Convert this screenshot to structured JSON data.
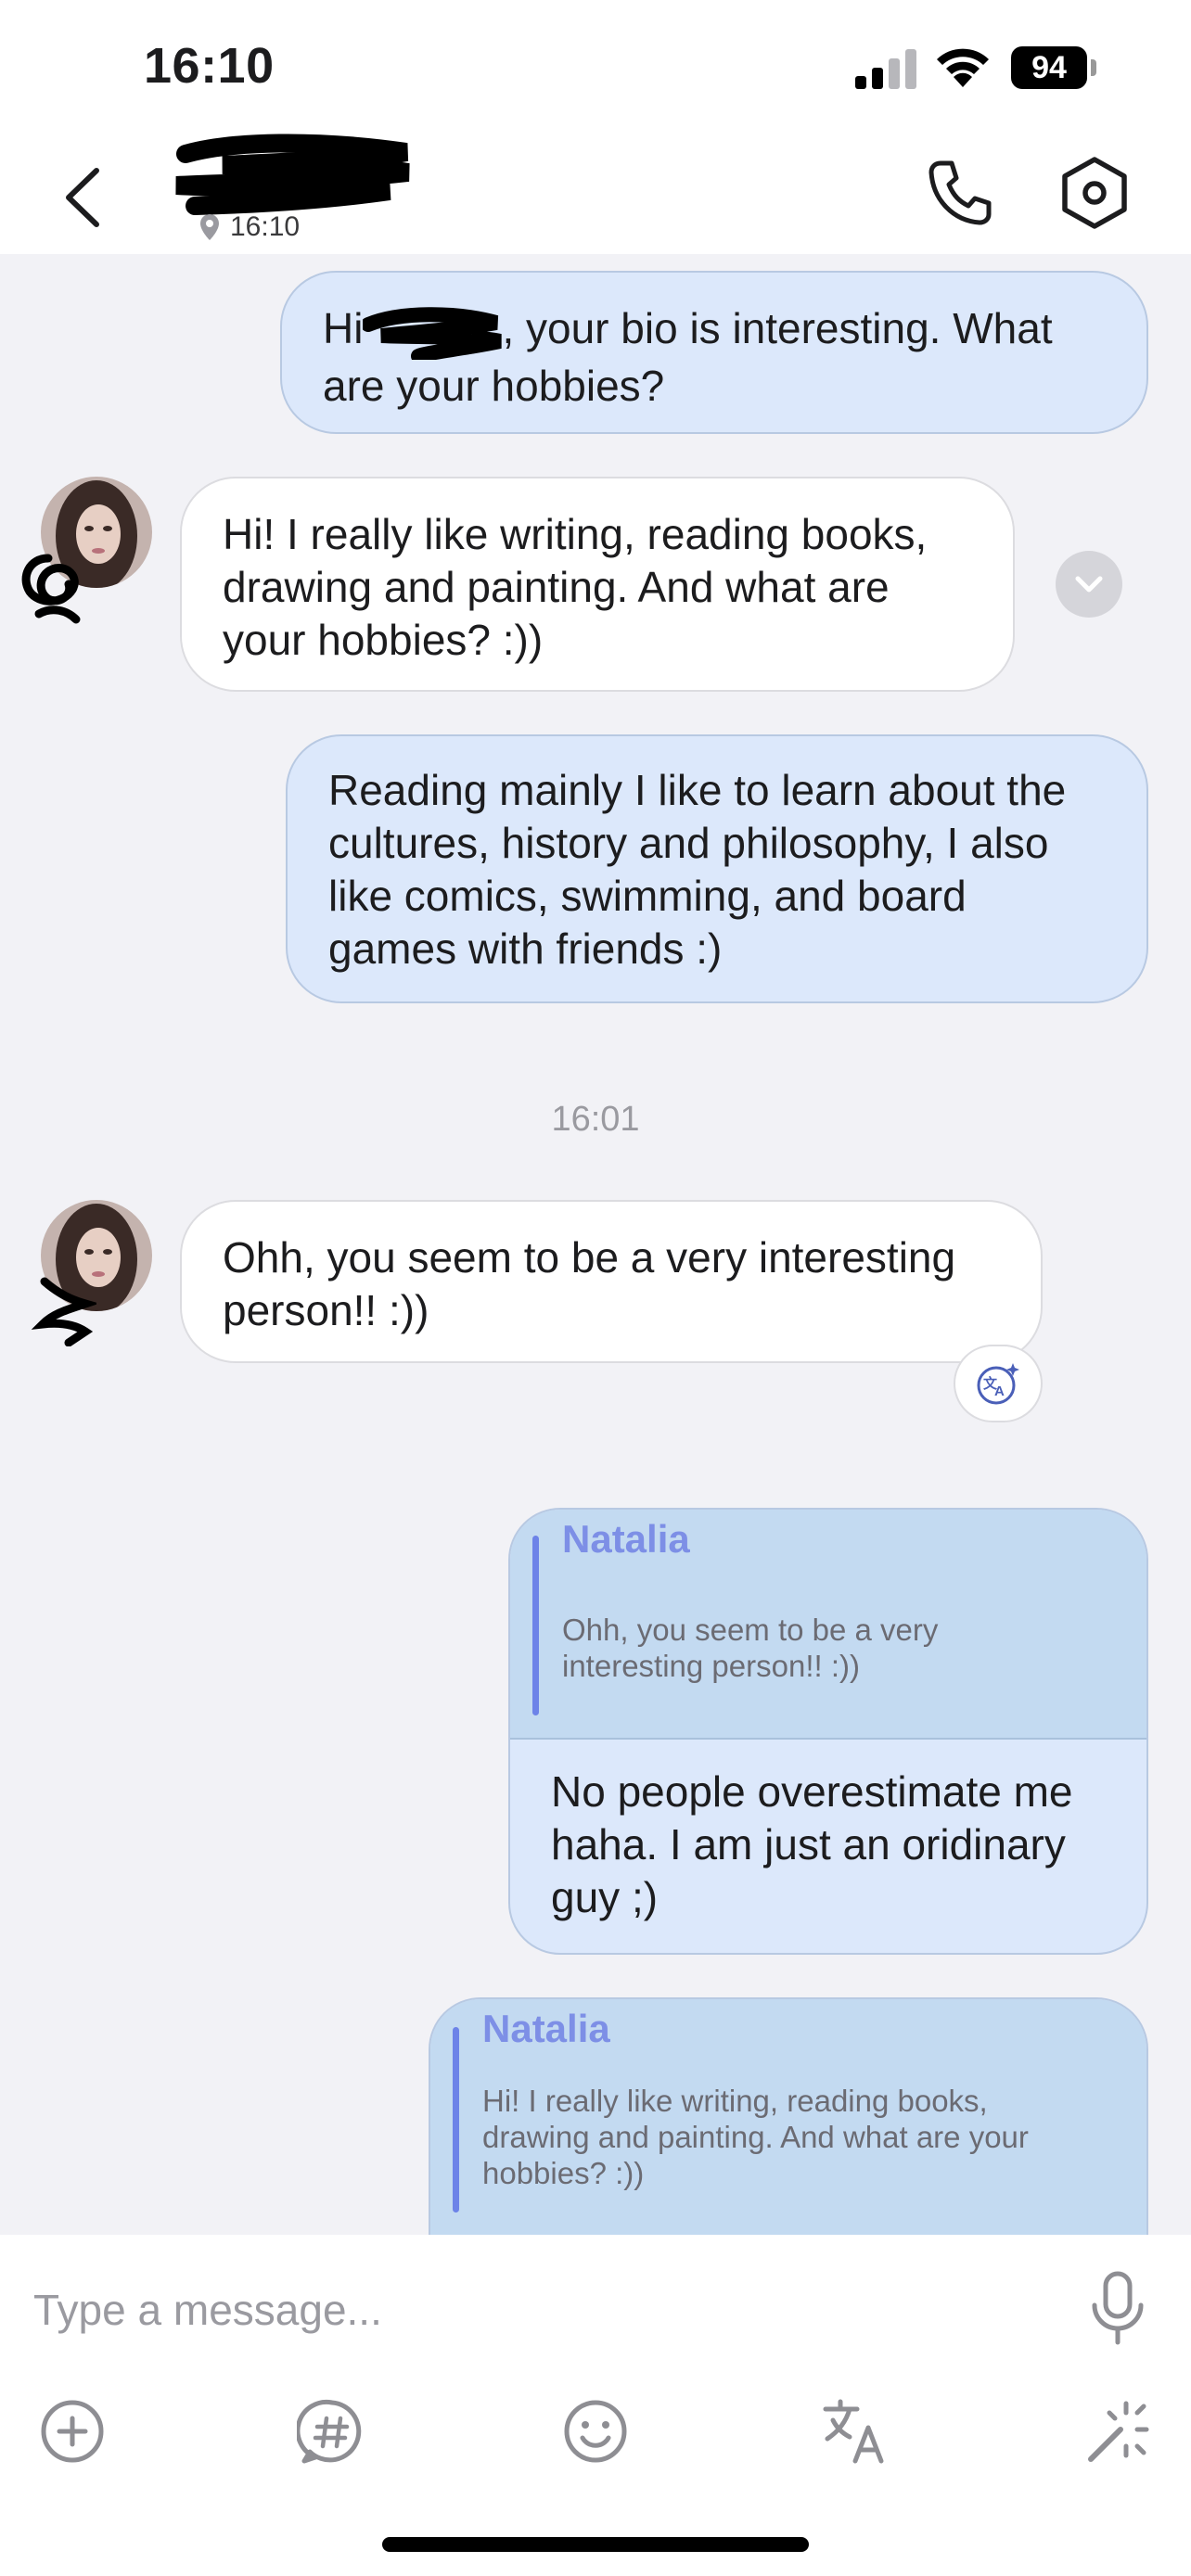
{
  "status_bar": {
    "time": "16:10",
    "battery": "94",
    "signal_icon": "cellular-signal-icon",
    "wifi_icon": "wifi-icon"
  },
  "header": {
    "contact_name": "",
    "last_seen": "16:10",
    "icons": [
      "chevron-left-icon",
      "location-pin-icon",
      "phone-icon",
      "settings-hexagon-icon"
    ]
  },
  "messages": [
    {
      "direction": "outgoing",
      "text_before_redaction": "Hi",
      "text_after_redaction": ", your bio is interesting. What are your hobbies?"
    },
    {
      "direction": "incoming",
      "text": "Hi! I really like writing, reading books, drawing and painting. And what are your hobbies? :))"
    },
    {
      "direction": "outgoing",
      "text": "Reading mainly I like to learn about the cultures, history and philosophy, I also like comics, swimming, and board games with friends :)"
    },
    {
      "direction": "incoming",
      "text": "Ohh, you seem to be a very interesting person!! :))"
    },
    {
      "direction": "outgoing",
      "reply_to": {
        "name": "Natalia",
        "text": "Ohh, you seem to be a very interesting person!! :))"
      },
      "text": "No people overestimate me haha. I am just an oridinary guy ;)"
    },
    {
      "direction": "outgoing",
      "reply_to": {
        "name": "Natalia",
        "text": "Hi! I really like writing, reading books, drawing and painting. And what are your hobbies? :))"
      },
      "text": ""
    }
  ],
  "time_separator": "16:01",
  "composer": {
    "placeholder": "Type a message...",
    "toolbar": [
      "add-icon",
      "hashtag-icon",
      "emoji-icon",
      "translate-icon",
      "magic-wand-icon"
    ]
  },
  "colors": {
    "outgoing_bubble": "#dce8fb",
    "incoming_bubble": "#ffffff",
    "quote_background": "#c3daf1",
    "quote_accent": "#6d83e8",
    "chat_background": "#f2f2f6"
  }
}
